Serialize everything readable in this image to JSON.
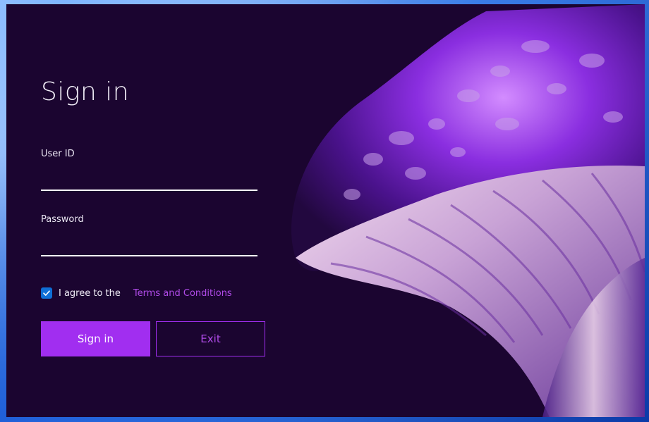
{
  "signin": {
    "title": "Sign in",
    "user_id_label": "User ID",
    "user_id_value": "",
    "password_label": "Password",
    "password_value": "",
    "agree_checked": true,
    "agree_text": "I agree to the",
    "terms_link": "Terms and Conditions",
    "sign_in_button": "Sign in",
    "exit_button": "Exit"
  },
  "colors": {
    "window_bg": "#1b0530",
    "accent": "#a12ef0",
    "link": "#b04be8",
    "checkbox": "#0f6fd6"
  }
}
